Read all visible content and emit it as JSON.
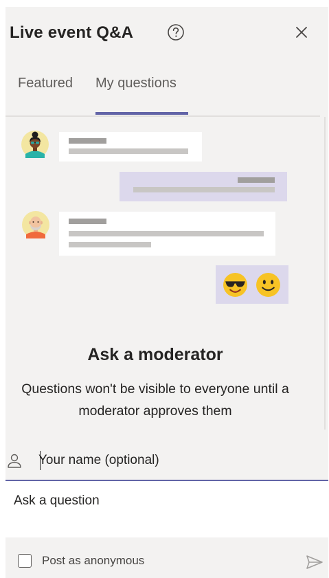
{
  "header": {
    "title": "Live event Q&A",
    "help_icon": "question-circle-icon",
    "close_icon": "close-icon"
  },
  "tabs": [
    {
      "label": "Featured",
      "selected": false
    },
    {
      "label": "My questions",
      "selected": true
    }
  ],
  "illustration": {
    "emoji": [
      "😎",
      "🙂"
    ],
    "avatars": [
      "avatar-woman-icon",
      "avatar-bald-man-icon"
    ]
  },
  "empty_state": {
    "title": "Ask a moderator",
    "description_line1": "Questions won't be visible to everyone until a",
    "description_line2": "moderator approves them"
  },
  "compose": {
    "name_placeholder": "Your name (optional)",
    "question_placeholder": "Ask a question",
    "anonymous_label": "Post as anonymous",
    "person_icon": "person-icon",
    "send_icon": "send-icon"
  },
  "colors": {
    "accent": "#6264a7",
    "panel_bg": "#f3f2f1",
    "bubble_self": "#dcd8ec"
  }
}
